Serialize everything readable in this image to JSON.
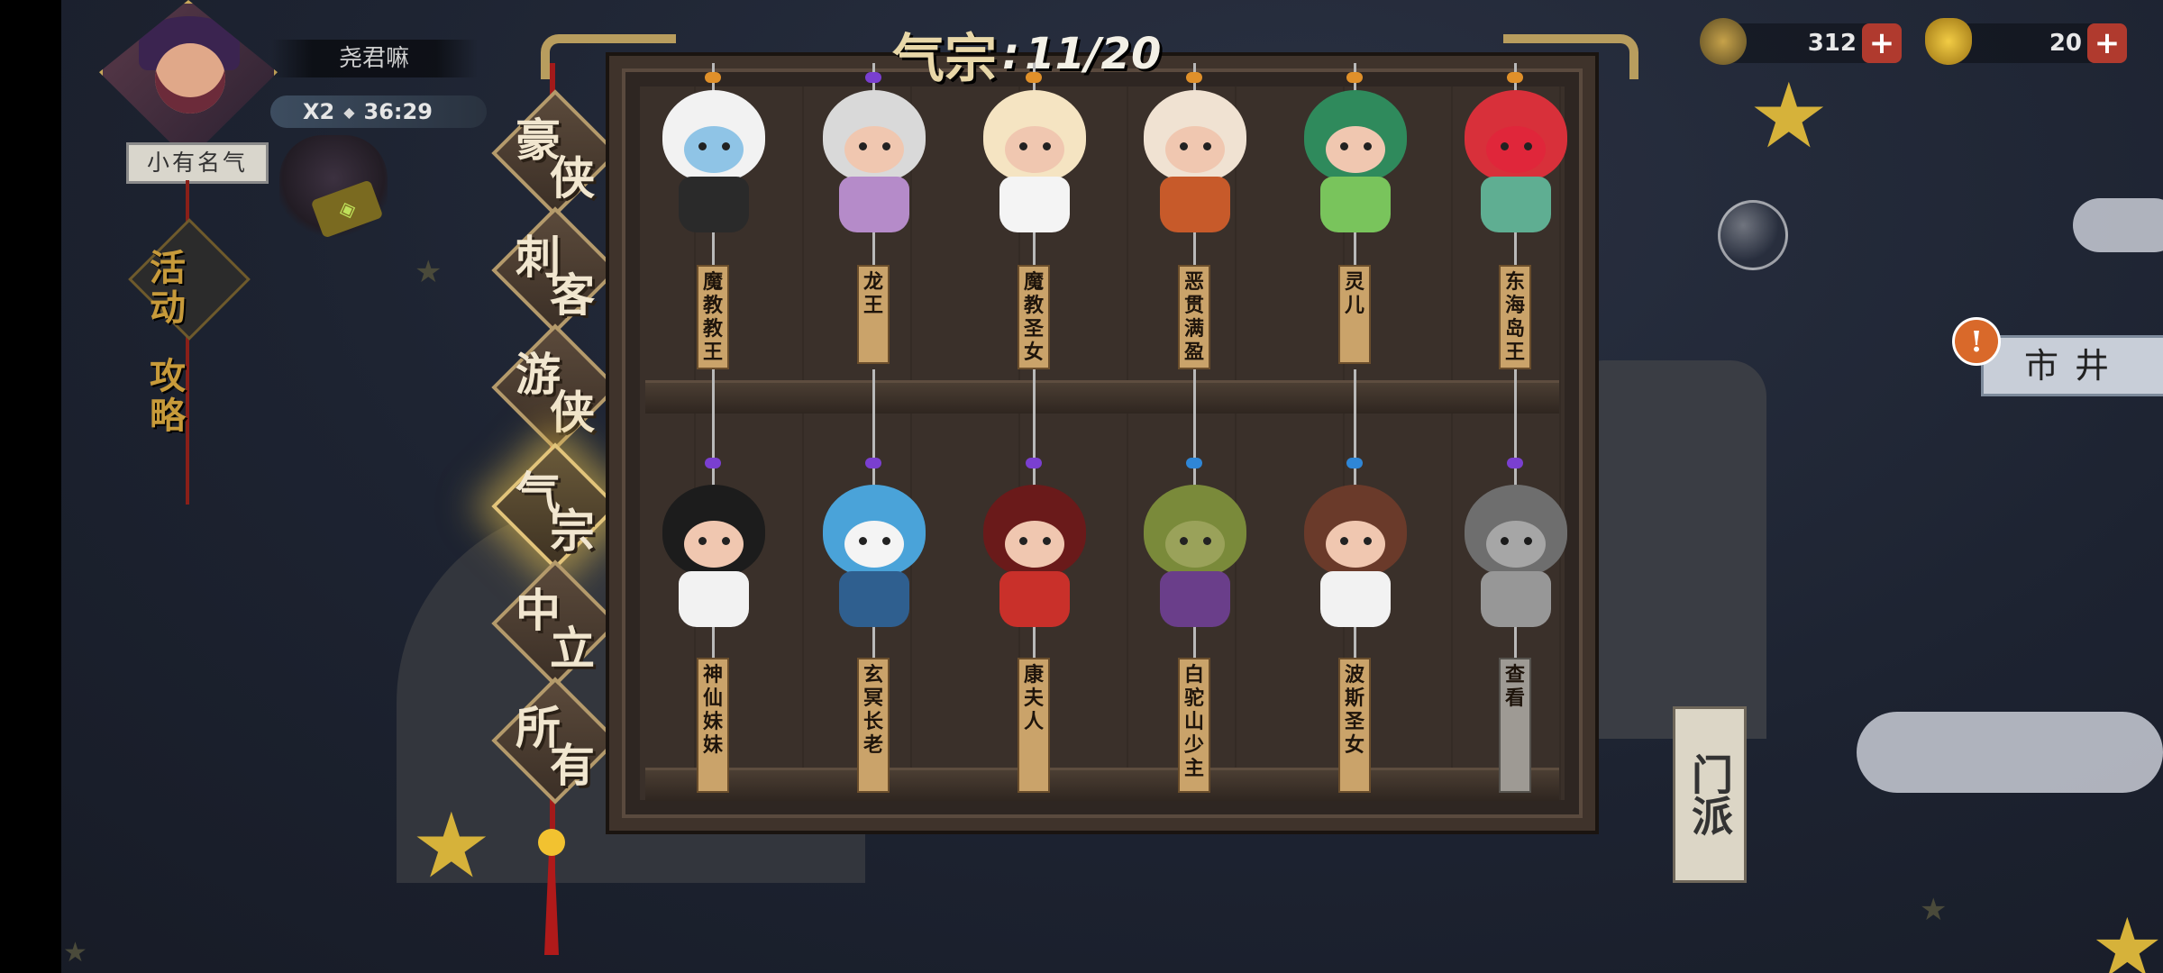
{
  "player": {
    "name": "尧君嘛",
    "multiplier": "X2",
    "timer": "36:29",
    "fame_title": "小有名气"
  },
  "left_menu": {
    "activity_label": "活动",
    "guide_label": "攻略"
  },
  "currencies": {
    "leaf": "312",
    "gold_ingot": "20"
  },
  "market_sign": "市井",
  "sect_sign": "门派",
  "categories": [
    {
      "label": [
        "豪",
        "侠"
      ],
      "active": false
    },
    {
      "label": [
        "刺",
        "客"
      ],
      "active": false
    },
    {
      "label": [
        "游",
        "侠"
      ],
      "active": false
    },
    {
      "label": [
        "气",
        "宗"
      ],
      "active": true
    },
    {
      "label": [
        "中",
        "立"
      ],
      "active": false
    },
    {
      "label": [
        "所",
        "有"
      ],
      "active": false
    }
  ],
  "cabinet": {
    "category_title": "气宗",
    "count_text": "11/20",
    "top_row": [
      {
        "name": "魔教教王",
        "hair": "#f2f2f2",
        "cloth": "#2a2a2a",
        "face": "#8fc4e6",
        "locked": false
      },
      {
        "name": "龙王",
        "hair": "#d9d9d9",
        "cloth": "#b58bc9",
        "face": "#f0c7b0",
        "locked": false
      },
      {
        "name": "魔教圣女",
        "hair": "#f5e4c2",
        "cloth": "#f4f4f4",
        "face": "#f0c7b0",
        "locked": false
      },
      {
        "name": "恶贯满盈",
        "hair": "#f0e2d2",
        "cloth": "#c75a2a",
        "face": "#f0c7b0",
        "locked": false
      },
      {
        "name": "灵儿",
        "hair": "#2f8a5c",
        "cloth": "#79c45c",
        "face": "#f0c7b0",
        "locked": false
      },
      {
        "name": "东海岛王",
        "hair": "#d8303a",
        "cloth": "#5fae92",
        "face": "#e0263a",
        "locked": false
      }
    ],
    "bottom_row": [
      {
        "name": "神仙妹妹",
        "hair": "#1c1c1c",
        "cloth": "#f2f2f2",
        "face": "#f0c7b0",
        "locked": false
      },
      {
        "name": "玄冥长老",
        "hair": "#4aa3d9",
        "cloth": "#2f5f8f",
        "face": "#f4f4f4",
        "locked": false
      },
      {
        "name": "康夫人",
        "hair": "#6a1a1a",
        "cloth": "#c9302a",
        "face": "#f0c7b0",
        "locked": false
      },
      {
        "name": "白驼山少主",
        "hair": "#7a8a3a",
        "cloth": "#6a3e8a",
        "face": "#9aa25a",
        "locked": false
      },
      {
        "name": "波斯圣女",
        "hair": "#6a3a2a",
        "cloth": "#f2f2f2",
        "face": "#f0c7b0",
        "locked": false
      },
      {
        "name": "查看",
        "hair": "#8a8a8a",
        "cloth": "#bdbdbd",
        "face": "#cfcfcf",
        "locked": true
      }
    ]
  },
  "colors": {
    "gold": "#c9a85b",
    "active_glow": "#ecc450",
    "rope": "#a31a1a",
    "plus_button": "#b03a2e"
  }
}
